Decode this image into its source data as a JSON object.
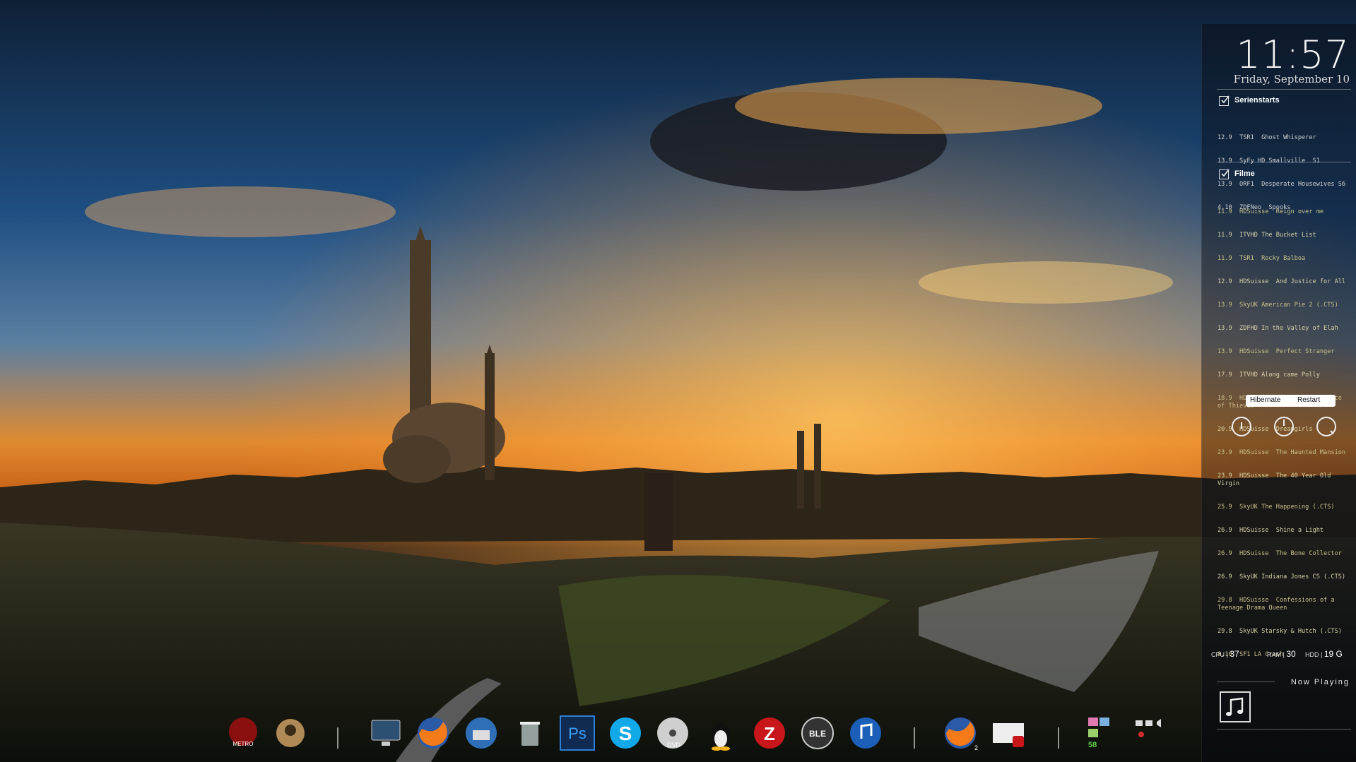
{
  "clock": {
    "time": "11:57",
    "date": "Friday, September 10"
  },
  "series": {
    "title": "Serienstarts",
    "items": [
      "12.9  TSR1  Ghost Whisperer",
      "13.9  SyFy HD Smallville  S1",
      "13.9  ORF1  Desperate Housewives S6",
      "4.10  ZDFNeo  Spooks"
    ]
  },
  "films": {
    "title": "Filme",
    "items": [
      "11.9  HDSuisse  Reign over me",
      "11.9  ITVHD The Bucket List",
      "11.9  TSR1  Rocky Balboa",
      "12.9  HDSuisse  And Justice for All",
      "13.9  SkyUK American Pie 2 (.CTS)",
      "13.9  ZDFHD In the Valley of Elah",
      "13.9  HDSuisse  Perfect Stranger",
      "17.9  ITVHD Along came Polly",
      "18.9  HDSuisse  Robin Hood: Prince of Thieves",
      "20.9  HDSuisse  Dreamgirls",
      "23.9  HDSuisse  The Haunted Mansion",
      "23.9  HDSuisse  The 40 Year Old Virgin",
      "25.9  SkyUK The Happening (.CTS)",
      "26.9  HDSuisse  Shine a Light",
      "26.9  HDSuisse  The Bone Collector",
      "26.9  SkyUK Indiana Jones CS (.CTS)",
      "29.8  HDSuisse  Confessions of a Teenage Drama Queen",
      "29.8  SkyUK Starsky & Hutch (.CTS)",
      "8.10  SF1 LA Crash"
    ]
  },
  "power": {
    "hibernate": "Hibernate",
    "restart": "Restart"
  },
  "stats": {
    "cpu_label": "CPU",
    "cpu": "37",
    "ram_label": "RAM",
    "ram": "30",
    "hdd_label": "HDD",
    "hdd": "19 G"
  },
  "now_playing": {
    "title": "Now Playing"
  },
  "dock": {
    "icons": [
      {
        "name": "metro-2033-icon",
        "badge": "METRO"
      },
      {
        "name": "game-warrior-icon"
      },
      {
        "name": "computer-icon"
      },
      {
        "name": "firefox-icon"
      },
      {
        "name": "thunderbird-icon"
      },
      {
        "name": "recycle-bin-icon"
      },
      {
        "name": "photoshop-icon",
        "badge": "Ps"
      },
      {
        "name": "skype-icon"
      },
      {
        "name": "dvd-icon",
        "badge": "DVD"
      },
      {
        "name": "linux-tux-icon"
      },
      {
        "name": "filezilla-icon"
      },
      {
        "name": "ble-icon",
        "badge": "BLE"
      },
      {
        "name": "itunes-icon"
      },
      {
        "name": "firefox-running-icon",
        "count": "2"
      },
      {
        "name": "filezilla-window-icon"
      },
      {
        "name": "system-tray-icon",
        "count": "58"
      }
    ]
  },
  "colors": {
    "accent": "#ff8a1e",
    "panel": "#0a0e18",
    "text": "#ffffff"
  }
}
